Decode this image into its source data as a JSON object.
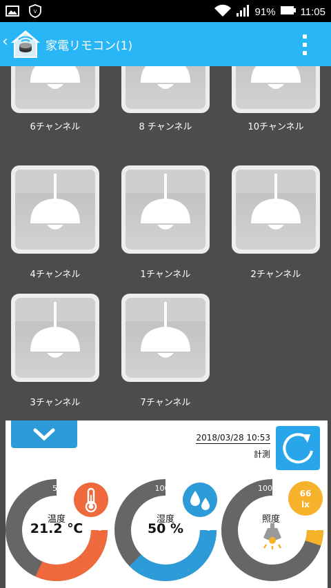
{
  "status_bar": {
    "battery": "91%",
    "time": "11:05"
  },
  "app_bar": {
    "title": "家電リモコン(1)"
  },
  "channels": [
    {
      "label": "6チャンネル"
    },
    {
      "label": "8 チャンネル"
    },
    {
      "label": "10チャンネル"
    },
    {
      "label": "4チャンネル"
    },
    {
      "label": "1チャンネル"
    },
    {
      "label": "2チャンネル"
    },
    {
      "label": "3チャンネル"
    },
    {
      "label": "7チャンネル"
    }
  ],
  "measurement": {
    "timestamp": "2018/03/28 10:53",
    "label": "計測"
  },
  "gauges": [
    {
      "name": "温度",
      "value": "21.2 ℃",
      "max": "50",
      "min": "0",
      "fraction": 0.424,
      "color": "#ee6a3c"
    },
    {
      "name": "湿度",
      "value": "50 %",
      "max": "100",
      "min": "0",
      "fraction": 0.5,
      "color": "#2d9bd8"
    },
    {
      "name": "照度",
      "badge": "66",
      "unit": "lx",
      "max": "1000",
      "min": "0",
      "fraction": 0.066,
      "color": "#f6b22b"
    }
  ],
  "colors": {
    "app_bar": "#29b6f6",
    "background": "#4d4c4a",
    "track": "#666666"
  }
}
